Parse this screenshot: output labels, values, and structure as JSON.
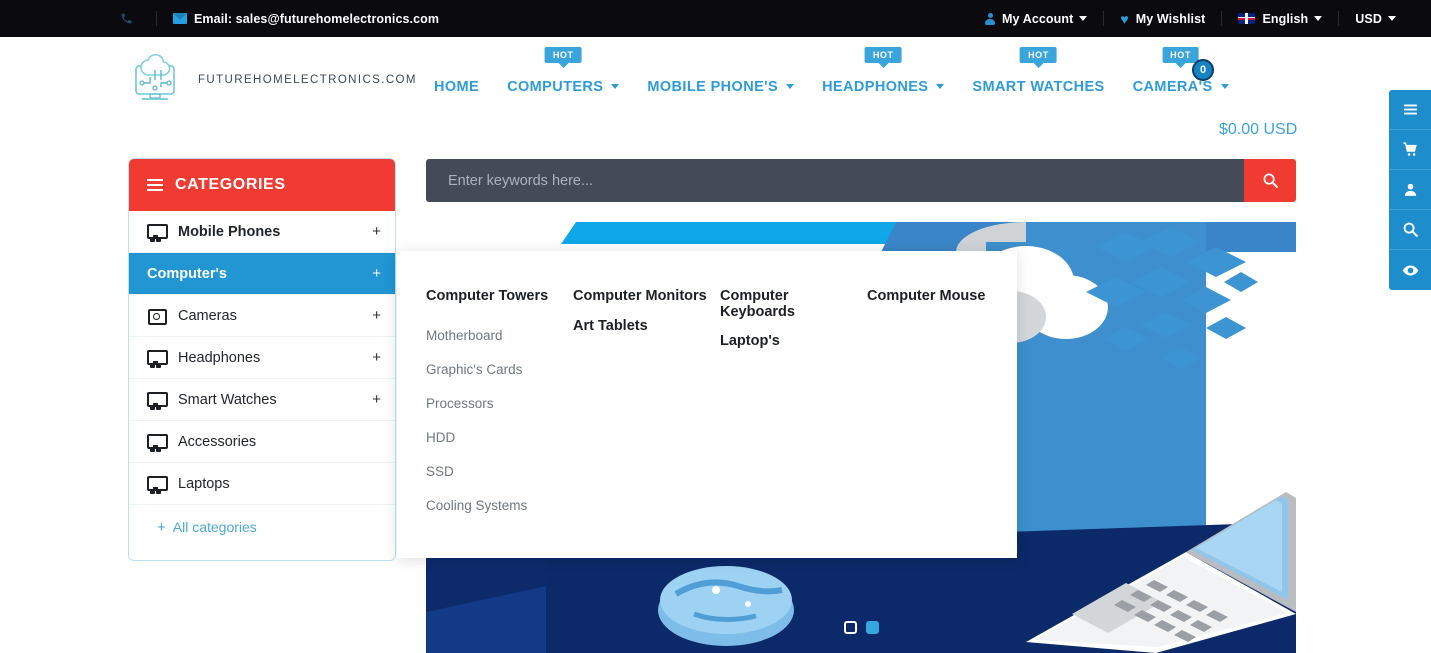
{
  "topbar": {
    "phone_icon": "phone-icon",
    "email_icon": "envelope-icon",
    "email": "Email: sales@futurehomelectronics.com",
    "account": "My Account",
    "wishlist": "My Wishlist",
    "language": "English",
    "currency": "USD"
  },
  "header": {
    "logo_text": "FUTUREHOMELECTRONICS.COM",
    "nav": [
      {
        "label": "HOME",
        "caret": false,
        "hot": ""
      },
      {
        "label": "COMPUTERS",
        "caret": true,
        "hot": "HOT"
      },
      {
        "label": "MOBILE PHONE'S",
        "caret": true,
        "hot": ""
      },
      {
        "label": "HEADPHONES",
        "caret": true,
        "hot": "HOT"
      },
      {
        "label": "SMART WATCHES",
        "caret": false,
        "hot": "HOT"
      },
      {
        "label": "CAMERA'S",
        "caret": true,
        "hot": "HOT"
      }
    ],
    "cart_count": "0",
    "cart_total": "$0.00 USD"
  },
  "categories": {
    "title": "CATEGORIES",
    "items": [
      {
        "label": "Mobile Phones",
        "plus": "+",
        "icon": "monitor-icon",
        "bold": true,
        "active": false
      },
      {
        "label": "Computer's",
        "plus": "+",
        "icon": "none",
        "bold": true,
        "active": true
      },
      {
        "label": "Cameras",
        "plus": "+",
        "icon": "camera-icon",
        "bold": false,
        "active": false
      },
      {
        "label": "Headphones",
        "plus": "+",
        "icon": "monitor-icon",
        "bold": false,
        "active": false
      },
      {
        "label": "Smart Watches",
        "plus": "+",
        "icon": "monitor-icon",
        "bold": false,
        "active": false
      },
      {
        "label": "Accessories",
        "plus": "",
        "icon": "monitor-icon",
        "bold": false,
        "active": false
      },
      {
        "label": "Laptops",
        "plus": "",
        "icon": "monitor-icon",
        "bold": false,
        "active": false
      }
    ],
    "all_categories": "All categories",
    "all_categories_plus": "+"
  },
  "search": {
    "placeholder": "Enter keywords here...",
    "value": "",
    "button_icon": "search-icon"
  },
  "mega_menu": {
    "columns": [
      {
        "heading": "Computer Towers",
        "heading2": "",
        "subs": [
          "Motherboard",
          "Graphic's Cards",
          "Processors",
          "HDD",
          "SSD",
          "Cooling Systems"
        ]
      },
      {
        "heading": "Computer Monitors",
        "heading2": "Art Tablets",
        "subs": []
      },
      {
        "heading": "Computer Keyboards",
        "heading2": "Laptop's",
        "subs": []
      },
      {
        "heading": "Computer Mouse",
        "heading2": "",
        "subs": []
      }
    ]
  },
  "banner": {
    "dots": [
      {
        "active": false
      },
      {
        "active": true
      }
    ]
  },
  "rail": {
    "buttons": [
      {
        "icon": "menu-icon"
      },
      {
        "icon": "cart-icon"
      },
      {
        "icon": "user-icon"
      },
      {
        "icon": "search-icon"
      },
      {
        "icon": "eye-icon"
      }
    ]
  },
  "colors": {
    "accent_blue": "#2e9cd8",
    "red": "#ef3b31",
    "dark_navy": "#0a0a0f",
    "rail_blue": "#1e8dcb",
    "search_bg": "#444b57"
  }
}
